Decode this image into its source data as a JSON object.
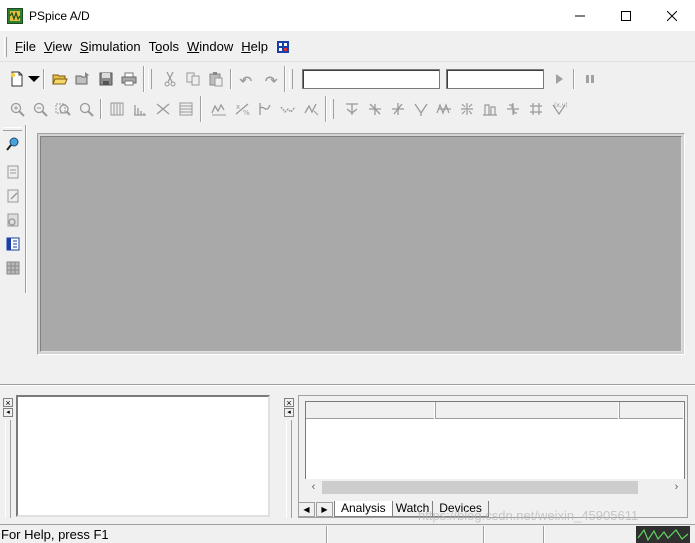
{
  "window": {
    "title": "PSpice A/D",
    "controls": [
      "minimize-icon",
      "maximize-icon",
      "close-icon"
    ]
  },
  "menu": {
    "items": [
      {
        "mnemonic": "F",
        "rest": "ile"
      },
      {
        "mnemonic": "V",
        "rest": "iew"
      },
      {
        "mnemonic": "S",
        "rest": "imulation"
      },
      {
        "mnemonic": "T",
        "rest": "ools"
      },
      {
        "mnemonic": "W",
        "rest": "indow"
      },
      {
        "mnemonic": "H",
        "rest": "elp"
      }
    ]
  },
  "toolbar1": {
    "profile_combo": {
      "value": ""
    },
    "run_combo": {
      "value": ""
    },
    "icons": [
      "new-file-icon",
      "open-folder-icon",
      "open-recent-icon",
      "save-icon",
      "print-icon",
      "cut-icon",
      "copy-icon",
      "paste-icon",
      "undo-icon",
      "redo-icon",
      "run-icon",
      "pause-icon"
    ]
  },
  "toolbar2": {
    "icons": [
      "zoom-in-icon",
      "zoom-out-icon",
      "zoom-area-icon",
      "zoom-fit-icon",
      "log-x-icon",
      "fourier-icon",
      "performance-icon",
      "log-y-icon",
      "add-trace-icon",
      "eval-measure-icon",
      "add-plot-icon",
      "mark-label-icon",
      "cursor-peak-icon",
      "cursor-trough-icon",
      "cursor-slope-icon",
      "cursor-min-icon",
      "cursor-max-icon",
      "cursor-point-icon",
      "cursor-search-icon",
      "cursor-next-icon",
      "cursor-mark-icon",
      "mark-data-icon"
    ]
  },
  "left_toolbar": {
    "icons": [
      "probe-icon",
      "sim-profile-icon",
      "edit-profile-icon",
      "view-output-icon",
      "netlist-icon",
      "pattern-icon"
    ]
  },
  "bottom_panes": {
    "tabs": [
      "Analysis",
      "Watch",
      "Devices"
    ]
  },
  "status": {
    "help_text": "For Help, press F1",
    "watermark": "https://blog.csdn.net/weixin_45905611"
  },
  "colors": {
    "workspace": "#a9a9a9",
    "status_graph": "#2f2f2f"
  }
}
